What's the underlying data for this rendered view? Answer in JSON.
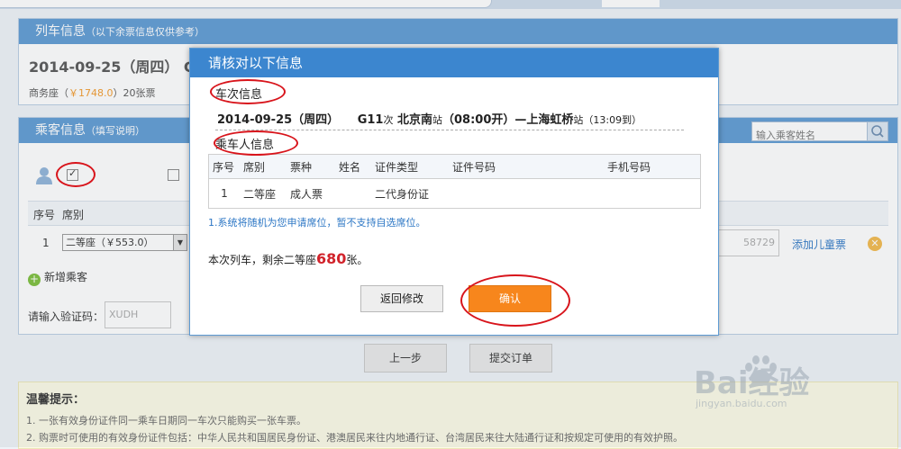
{
  "train_panel": {
    "title": "列车信息",
    "subtitle": "（以下余票信息仅供参考）",
    "date_line": "2014-09-25（周四） G",
    "seat_label": "商务座（",
    "seat_price": "￥1748.0",
    "seat_remain": "）20张票"
  },
  "passenger_panel": {
    "title": "乘客信息",
    "subtitle": "（填写说明）",
    "search_placeholder": "输入乘客姓名",
    "grid_head": {
      "seq": "序号",
      "seat": "席别"
    },
    "row": {
      "seq": "1",
      "seat_select": "二等座（￥553.0）",
      "phone_tail": "58729",
      "add_child": "添加儿童票"
    },
    "add_passenger": "新增乘客",
    "captcha_label": "请输入验证码：",
    "captcha_value": "XUDH"
  },
  "steps": {
    "prev": "上一步",
    "submit": "提交订单"
  },
  "tips": {
    "title": "温馨提示：",
    "line1": "1. 一张有效身份证件同一乘车日期同一车次只能购买一张车票。",
    "line2": "2. 购票时可使用的有效身份证件包括：中华人民共和国居民身份证、港澳居民来往内地通行证、台湾居民来往大陆通行证和按规定可使用的有效护照。"
  },
  "modal": {
    "title": "请核对以下信息",
    "section_train": "车次信息",
    "train_date": "2014-09-25（周四）",
    "train_no": "G11",
    "train_no_suffix": "次",
    "from_station": "北京南",
    "station_suffix": "站",
    "depart": "（08:00开）—",
    "to_station": "上海虹桥",
    "arrive": "（13:09到）",
    "section_passenger": "乘车人信息",
    "table_headers": [
      "序号",
      "席别",
      "票种",
      "姓名",
      "证件类型",
      "证件号码",
      "手机号码"
    ],
    "table_row": [
      "1",
      "二等座",
      "成人票",
      "",
      "二代身份证",
      "",
      ""
    ],
    "note": "1.系统将随机为您申请席位，暂不支持自选席位。",
    "remain_prefix": "本次列车，剩余二等座",
    "remain_count": "680",
    "remain_suffix": "张。",
    "btn_back": "返回修改",
    "btn_ok": "确认"
  },
  "watermark": {
    "brand": "Bai经验",
    "url": "jingyan.baidu.com"
  },
  "colors": {
    "header_blue": "#5d9ad3",
    "modal_blue": "#3c86cf",
    "confirm_orange": "#f7861c",
    "annotation_red": "#d8141b",
    "price_orange": "#f39a2b",
    "count_red": "#d1232b"
  }
}
